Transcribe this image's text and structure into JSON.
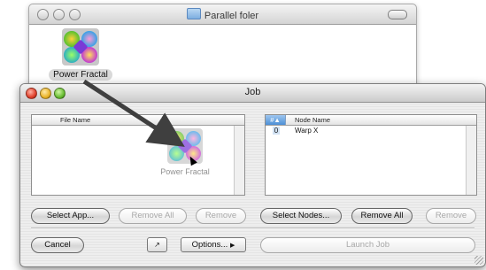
{
  "back_window": {
    "title": "Parallel foler",
    "file": {
      "label": "Power Fractal"
    }
  },
  "job_window": {
    "title": "Job",
    "left_list": {
      "header": "File Name",
      "drag_item": "Power Fractal"
    },
    "right_list": {
      "headers": {
        "num": "#▲",
        "node": "Node Name"
      },
      "rows": [
        {
          "index": "0",
          "name": "Warp X"
        }
      ]
    },
    "buttons": {
      "select_app": "Select App...",
      "remove_all_left": "Remove All",
      "remove_left": "Remove",
      "select_nodes": "Select Nodes...",
      "remove_all_right": "Remove All",
      "remove_right": "Remove",
      "cancel": "Cancel",
      "options": "Options...",
      "launch_job": "Launch Job"
    }
  }
}
